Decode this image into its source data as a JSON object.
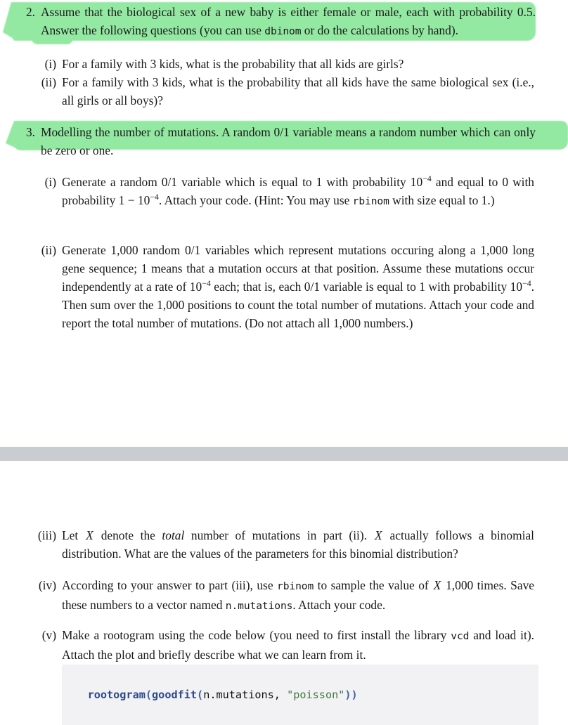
{
  "document": {
    "type": "homework-assignment",
    "highlight_color": "#8ae79b",
    "page_break_color": "#c9cdd2",
    "code_block_bg": "#f2f2f4"
  },
  "item2": {
    "marker": "2.",
    "highlighted": true,
    "text_parts": [
      {
        "kind": "text",
        "value": "Assume that the biological sex of a new baby is either female or male, each with probability 0.5. Answer the following questions (you can use "
      },
      {
        "kind": "code",
        "value": "dbinom"
      },
      {
        "kind": "text",
        "value": " or do the calculations by hand)."
      }
    ],
    "subitems": [
      {
        "marker": "(i)",
        "text_parts": [
          {
            "kind": "text",
            "value": "For a family with 3 kids, what is the probability that all kids are girls?"
          }
        ]
      },
      {
        "marker": "(ii)",
        "text_parts": [
          {
            "kind": "text",
            "value": "For a family with 3 kids, what is the probability that all kids have the same biological sex (i.e., all girls or all boys)?"
          }
        ]
      }
    ]
  },
  "item3": {
    "marker": "3.",
    "highlighted": true,
    "text_parts": [
      {
        "kind": "text",
        "value": "Modelling the number of mutations. A random 0/1 variable means a random number which can only be zero or one."
      }
    ],
    "subitems": [
      {
        "marker": "(i)",
        "text_parts": [
          {
            "kind": "text",
            "value": "Generate a random 0/1 variable which is equal to 1 with probability "
          },
          {
            "kind": "math",
            "base": "10",
            "exp": "−4"
          },
          {
            "kind": "text",
            "value": " and equal to 0 with probability "
          },
          {
            "kind": "math_expr",
            "value": "1 − "
          },
          {
            "kind": "math",
            "base": "10",
            "exp": "−4"
          },
          {
            "kind": "text",
            "value": ". Attach your code. (Hint: You may use "
          },
          {
            "kind": "code",
            "value": "rbinom"
          },
          {
            "kind": "text",
            "value": " with size equal to 1.)"
          }
        ]
      },
      {
        "marker": "(ii)",
        "text_parts": [
          {
            "kind": "text",
            "value": "Generate 1,000 random 0/1 variables which represent mutations occuring along a 1,000 long gene sequence; 1 means that a mutation occurs at that position. Assume these mutations occur independently at a rate of "
          },
          {
            "kind": "math",
            "base": "10",
            "exp": "−4"
          },
          {
            "kind": "text",
            "value": " each; that is, each 0/1 variable is equal to 1 with probability "
          },
          {
            "kind": "math",
            "base": "10",
            "exp": "−4"
          },
          {
            "kind": "text",
            "value": ". Then sum over the 1,000 positions to count the total number of mutations. Attach your code and report the total number of mutations. (Do not attach all 1,000 numbers.)"
          }
        ]
      },
      {
        "marker": "(iii)",
        "text_parts": [
          {
            "kind": "text",
            "value": "Let "
          },
          {
            "kind": "var",
            "value": "X"
          },
          {
            "kind": "text",
            "value": " denote the "
          },
          {
            "kind": "italic",
            "value": "total"
          },
          {
            "kind": "text",
            "value": " number of mutations in part (ii). "
          },
          {
            "kind": "var",
            "value": "X"
          },
          {
            "kind": "text",
            "value": " actually follows a binomial distribution. What are the values of the parameters for this binomial distribution?"
          }
        ]
      },
      {
        "marker": "(iv)",
        "text_parts": [
          {
            "kind": "text",
            "value": "According to your answer to part (iii), use "
          },
          {
            "kind": "code",
            "value": "rbinom"
          },
          {
            "kind": "text",
            "value": " to sample the value of "
          },
          {
            "kind": "var",
            "value": "X"
          },
          {
            "kind": "text",
            "value": " 1,000 times. Save these numbers to a vector named "
          },
          {
            "kind": "code",
            "value": "n.mutations"
          },
          {
            "kind": "text",
            "value": ". Attach your code."
          }
        ]
      },
      {
        "marker": "(v)",
        "text_parts": [
          {
            "kind": "text",
            "value": "Make a rootogram using the code below (you need to first install the library "
          },
          {
            "kind": "code",
            "value": "vcd"
          },
          {
            "kind": "text",
            "value": " and load it). Attach the plot and briefly describe what we can learn from it."
          }
        ],
        "code_listing": {
          "tokens": [
            {
              "type": "fn",
              "value": "rootogram"
            },
            {
              "type": "par",
              "value": "("
            },
            {
              "type": "fn",
              "value": "goodfit"
            },
            {
              "type": "par",
              "value": "("
            },
            {
              "type": "var",
              "value": "n.mutations, "
            },
            {
              "type": "str",
              "value": "\"poisson\""
            },
            {
              "type": "par",
              "value": "))"
            }
          ],
          "plain": "rootogram(goodfit(n.mutations, \"poisson\"))"
        }
      }
    ]
  }
}
